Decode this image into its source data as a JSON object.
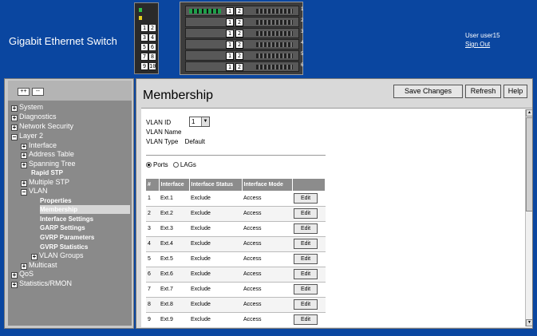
{
  "header": {
    "title": "Gigabit Ethernet Switch",
    "user_label": "User user15",
    "signout_label": "Sign Out",
    "module_ports": [
      "1",
      "2",
      "3",
      "4",
      "5",
      "6",
      "7",
      "8",
      "9",
      "10"
    ],
    "blade_slots": [
      {
        "a": "1",
        "b": "2",
        "n": "1"
      },
      {
        "a": "1",
        "b": "2",
        "n": "2"
      },
      {
        "a": "1",
        "b": "2",
        "n": "3"
      },
      {
        "a": "1",
        "b": "2",
        "n": "4"
      },
      {
        "a": "1",
        "b": "2",
        "n": "5"
      },
      {
        "a": "1",
        "b": "2",
        "n": "6"
      }
    ]
  },
  "nav": {
    "expand_all_label": "++",
    "collapse_all_label": "--",
    "items": [
      {
        "label": "System",
        "state": "+"
      },
      {
        "label": "Diagnostics",
        "state": "+"
      },
      {
        "label": "Network Security",
        "state": "+"
      },
      {
        "label": "Layer 2",
        "state": "−"
      },
      {
        "label": "Interface",
        "state": "+"
      },
      {
        "label": "Address Table",
        "state": "+"
      },
      {
        "label": "Spanning Tree",
        "state": "+"
      },
      {
        "label": "Rapid STP",
        "state": ""
      },
      {
        "label": "Multiple STP",
        "state": "+"
      },
      {
        "label": "VLAN",
        "state": "−"
      },
      {
        "label": "Properties",
        "state": ""
      },
      {
        "label": "Membership",
        "state": ""
      },
      {
        "label": "Interface Settings",
        "state": ""
      },
      {
        "label": "GARP Settings",
        "state": ""
      },
      {
        "label": "GVRP Parameters",
        "state": ""
      },
      {
        "label": "GVRP Statistics",
        "state": ""
      },
      {
        "label": "VLAN Groups",
        "state": "+"
      },
      {
        "label": "Multicast",
        "state": "+"
      },
      {
        "label": "QoS",
        "state": "+"
      },
      {
        "label": "Statistics/RMON",
        "state": "+"
      }
    ]
  },
  "content": {
    "title": "Membership",
    "buttons": {
      "save": "Save Changes",
      "refresh": "Refresh",
      "help": "Help"
    },
    "form": {
      "vlan_id_label": "VLAN ID",
      "vlan_id_value": "1",
      "vlan_name_label": "VLAN Name",
      "vlan_type_label": "VLAN Type",
      "vlan_type_value": "Default",
      "ports_label": "Ports",
      "lags_label": "LAGs",
      "selected": "Ports"
    },
    "table": {
      "headers": [
        "#",
        "Interface",
        "Interface Status",
        "Interface Mode",
        ""
      ],
      "rows": [
        {
          "num": "1",
          "iface": "Ext.1",
          "status": "Exclude",
          "mode": "Access",
          "action": "Edit"
        },
        {
          "num": "2",
          "iface": "Ext.2",
          "status": "Exclude",
          "mode": "Access",
          "action": "Edit"
        },
        {
          "num": "3",
          "iface": "Ext.3",
          "status": "Exclude",
          "mode": "Access",
          "action": "Edit"
        },
        {
          "num": "4",
          "iface": "Ext.4",
          "status": "Exclude",
          "mode": "Access",
          "action": "Edit"
        },
        {
          "num": "5",
          "iface": "Ext.5",
          "status": "Exclude",
          "mode": "Access",
          "action": "Edit"
        },
        {
          "num": "6",
          "iface": "Ext.6",
          "status": "Exclude",
          "mode": "Access",
          "action": "Edit"
        },
        {
          "num": "7",
          "iface": "Ext.7",
          "status": "Exclude",
          "mode": "Access",
          "action": "Edit"
        },
        {
          "num": "8",
          "iface": "Ext.8",
          "status": "Exclude",
          "mode": "Access",
          "action": "Edit"
        },
        {
          "num": "9",
          "iface": "Ext.9",
          "status": "Exclude",
          "mode": "Access",
          "action": "Edit"
        }
      ]
    }
  }
}
